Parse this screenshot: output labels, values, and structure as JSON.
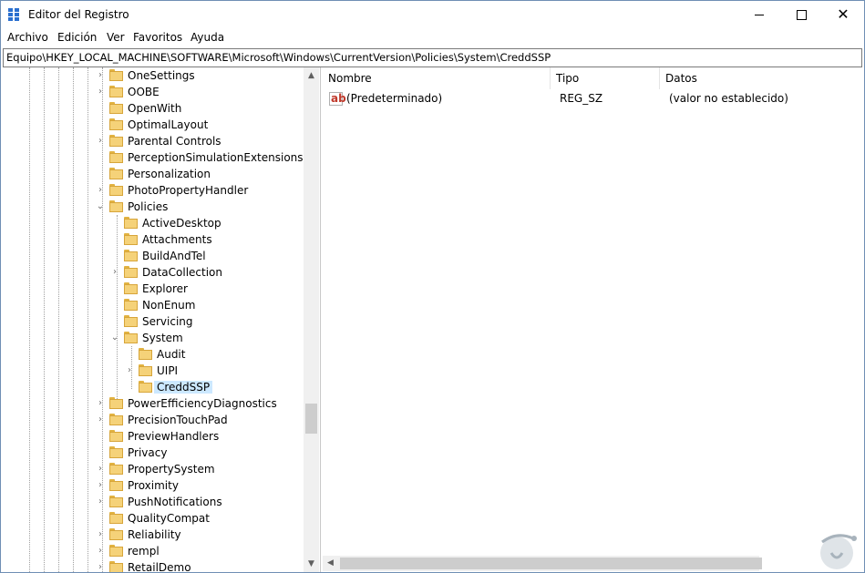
{
  "window": {
    "title": "Editor del Registro",
    "close_glyph": "✕"
  },
  "menu": {
    "items": [
      {
        "label": "Archivo"
      },
      {
        "label": "Edición"
      },
      {
        "label": "Ver"
      },
      {
        "label": "Favoritos"
      },
      {
        "label": "Ayuda"
      }
    ]
  },
  "address": {
    "path": "Equipo\\HKEY_LOCAL_MACHINE\\SOFTWARE\\Microsoft\\Windows\\CurrentVersion\\Policies\\System\\CreddSSP"
  },
  "tree": {
    "nodes": [
      {
        "label": "OneSettings",
        "expander": "›"
      },
      {
        "label": "OOBE",
        "expander": "›"
      },
      {
        "label": "OpenWith",
        "expander": ""
      },
      {
        "label": "OptimalLayout",
        "expander": ""
      },
      {
        "label": "Parental Controls",
        "expander": "›"
      },
      {
        "label": "PerceptionSimulationExtensions",
        "expander": ""
      },
      {
        "label": "Personalization",
        "expander": ""
      },
      {
        "label": "PhotoPropertyHandler",
        "expander": "›"
      },
      {
        "label": "Policies",
        "expander": "⌄"
      },
      {
        "label": "ActiveDesktop",
        "expander": ""
      },
      {
        "label": "Attachments",
        "expander": ""
      },
      {
        "label": "BuildAndTel",
        "expander": ""
      },
      {
        "label": "DataCollection",
        "expander": "›"
      },
      {
        "label": "Explorer",
        "expander": ""
      },
      {
        "label": "NonEnum",
        "expander": ""
      },
      {
        "label": "Servicing",
        "expander": ""
      },
      {
        "label": "System",
        "expander": "⌄"
      },
      {
        "label": "Audit",
        "expander": ""
      },
      {
        "label": "UIPI",
        "expander": "›"
      },
      {
        "label": "CreddSSP",
        "expander": ""
      },
      {
        "label": "PowerEfficiencyDiagnostics",
        "expander": "›"
      },
      {
        "label": "PrecisionTouchPad",
        "expander": "›"
      },
      {
        "label": "PreviewHandlers",
        "expander": ""
      },
      {
        "label": "Privacy",
        "expander": ""
      },
      {
        "label": "PropertySystem",
        "expander": "›"
      },
      {
        "label": "Proximity",
        "expander": "›"
      },
      {
        "label": "PushNotifications",
        "expander": "›"
      },
      {
        "label": "QualityCompat",
        "expander": ""
      },
      {
        "label": "Reliability",
        "expander": "›"
      },
      {
        "label": "rempl",
        "expander": "›"
      },
      {
        "label": "RetailDemo",
        "expander": "›"
      }
    ],
    "scroll_up": "▲",
    "scroll_down": "▼"
  },
  "list": {
    "columns": {
      "name": "Nombre",
      "type": "Tipo",
      "data": "Datos"
    },
    "rows": [
      {
        "icon_text": "ab",
        "name": "(Predeterminado)",
        "type": "REG_SZ",
        "data": "(valor no establecido)"
      }
    ],
    "scroll_left": "◀"
  },
  "colors": {
    "selection": "#cce8ff",
    "folder": "#f5d279",
    "accent": "#2a6fcf"
  }
}
